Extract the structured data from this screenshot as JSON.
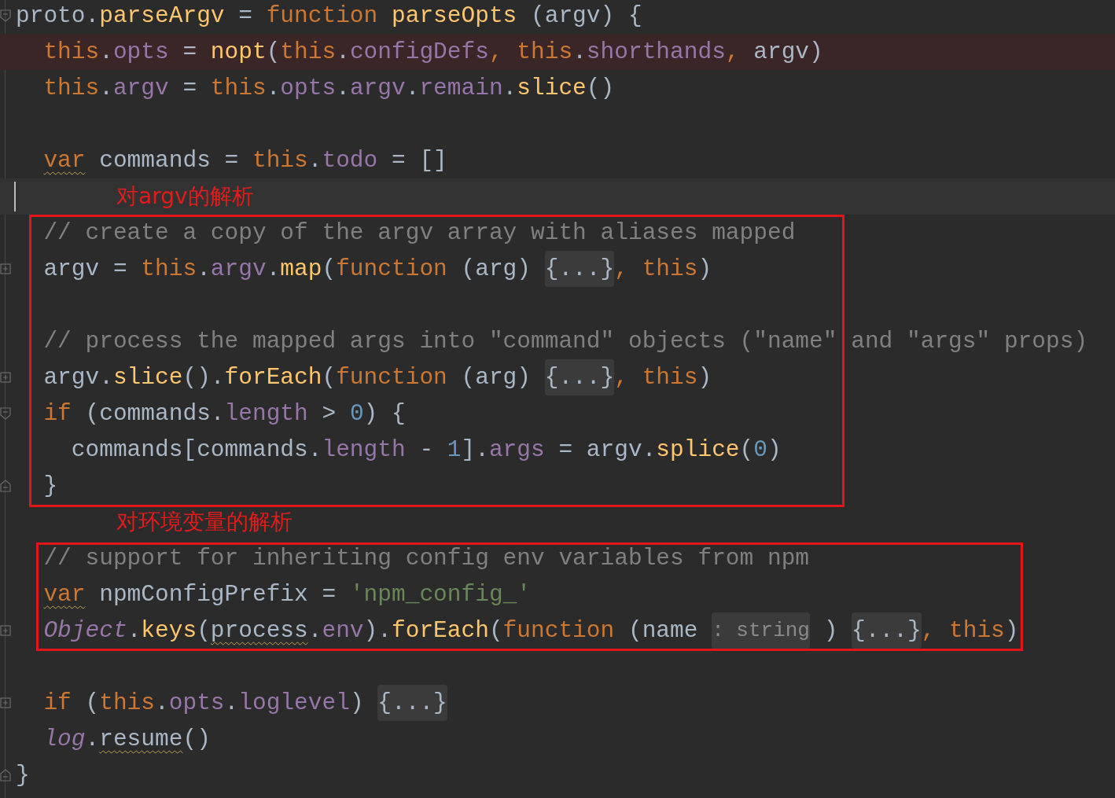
{
  "blocks": [
    {
      "boxed": false,
      "lines": [
        {
          "kind": "code",
          "gutter": {
            "kind": "start"
          },
          "tokens": [
            {
              "kind": "t",
              "s": "proto."
            },
            {
              "kind": "f",
              "s": "parseArgv"
            },
            {
              "kind": "t",
              "s": " = "
            },
            {
              "kind": "k",
              "s": "function "
            },
            {
              "kind": "f",
              "s": "parseOpts"
            },
            {
              "kind": "t",
              "s": " (argv) {"
            }
          ]
        },
        {
          "kind": "code",
          "error": true,
          "tokens": [
            {
              "kind": "k",
              "s": "  this"
            },
            {
              "kind": "t",
              "s": "."
            },
            {
              "kind": "p",
              "s": "opts"
            },
            {
              "kind": "t",
              "s": " = "
            },
            {
              "kind": "f",
              "s": "nopt"
            },
            {
              "kind": "t",
              "s": "("
            },
            {
              "kind": "k",
              "s": "this"
            },
            {
              "kind": "t",
              "s": "."
            },
            {
              "kind": "p",
              "s": "configDefs"
            },
            {
              "kind": "k",
              "s": ", this"
            },
            {
              "kind": "t",
              "s": "."
            },
            {
              "kind": "p",
              "s": "shorthands"
            },
            {
              "kind": "k",
              "s": ", "
            },
            {
              "kind": "t",
              "s": "argv)"
            }
          ]
        },
        {
          "kind": "code",
          "tokens": [
            {
              "kind": "k",
              "s": "  this"
            },
            {
              "kind": "t",
              "s": "."
            },
            {
              "kind": "p",
              "s": "argv"
            },
            {
              "kind": "t",
              "s": " = "
            },
            {
              "kind": "k",
              "s": "this"
            },
            {
              "kind": "t",
              "s": "."
            },
            {
              "kind": "p",
              "s": "opts"
            },
            {
              "kind": "t",
              "s": "."
            },
            {
              "kind": "p",
              "s": "argv"
            },
            {
              "kind": "t",
              "s": "."
            },
            {
              "kind": "p",
              "s": "remain"
            },
            {
              "kind": "t",
              "s": "."
            },
            {
              "kind": "f",
              "s": "slice"
            },
            {
              "kind": "t",
              "s": "()"
            }
          ]
        },
        {
          "kind": "blank"
        },
        {
          "kind": "code",
          "tokens": [
            {
              "kind": "k",
              "s": "  var",
              "warn": true
            },
            {
              "kind": "t",
              "s": " commands = "
            },
            {
              "kind": "k",
              "s": "this"
            },
            {
              "kind": "t",
              "s": "."
            },
            {
              "kind": "p",
              "s": "todo"
            },
            {
              "kind": "t",
              "s": " = []"
            }
          ]
        },
        {
          "kind": "annotation",
          "caret": true,
          "annotation": "对argv的解析"
        }
      ]
    },
    {
      "boxed": true,
      "lines": [
        {
          "kind": "code",
          "tokens": [
            {
              "kind": "c",
              "s": "  // create a copy of the argv array with aliases mapped"
            }
          ]
        },
        {
          "kind": "code",
          "gutter": {
            "kind": "plus"
          },
          "tokens": [
            {
              "kind": "t",
              "s": "  argv = "
            },
            {
              "kind": "k",
              "s": "this"
            },
            {
              "kind": "t",
              "s": "."
            },
            {
              "kind": "p",
              "s": "argv"
            },
            {
              "kind": "t",
              "s": "."
            },
            {
              "kind": "f",
              "s": "map"
            },
            {
              "kind": "t",
              "s": "("
            },
            {
              "kind": "k",
              "s": "function "
            },
            {
              "kind": "t",
              "s": "(arg) "
            },
            {
              "kind": "fold",
              "s": "{...}"
            },
            {
              "kind": "k",
              "s": ", this"
            },
            {
              "kind": "t",
              "s": ")"
            }
          ]
        },
        {
          "kind": "blank"
        },
        {
          "kind": "code",
          "tokens": [
            {
              "kind": "c",
              "s": "  // process the mapped args into \"command\" objects (\"name\" and \"args\" props)"
            }
          ]
        },
        {
          "kind": "code",
          "gutter": {
            "kind": "plus"
          },
          "tokens": [
            {
              "kind": "t",
              "s": "  argv."
            },
            {
              "kind": "f",
              "s": "slice"
            },
            {
              "kind": "t",
              "s": "()."
            },
            {
              "kind": "f",
              "s": "forEach"
            },
            {
              "kind": "t",
              "s": "("
            },
            {
              "kind": "k",
              "s": "function "
            },
            {
              "kind": "t",
              "s": "(arg) "
            },
            {
              "kind": "fold",
              "s": "{...}"
            },
            {
              "kind": "k",
              "s": ", this"
            },
            {
              "kind": "t",
              "s": ")"
            }
          ]
        },
        {
          "kind": "code",
          "gutter": {
            "kind": "start"
          },
          "tokens": [
            {
              "kind": "k",
              "s": "  if "
            },
            {
              "kind": "t",
              "s": "(commands."
            },
            {
              "kind": "p",
              "s": "length"
            },
            {
              "kind": "t",
              "s": " > "
            },
            {
              "kind": "n",
              "s": "0"
            },
            {
              "kind": "t",
              "s": ") {"
            }
          ]
        },
        {
          "kind": "code",
          "tokens": [
            {
              "kind": "t",
              "s": "    commands[commands."
            },
            {
              "kind": "p",
              "s": "length"
            },
            {
              "kind": "t",
              "s": " - "
            },
            {
              "kind": "n",
              "s": "1"
            },
            {
              "kind": "t",
              "s": "]."
            },
            {
              "kind": "p",
              "s": "args"
            },
            {
              "kind": "t",
              "s": " = argv."
            },
            {
              "kind": "f",
              "s": "splice"
            },
            {
              "kind": "t",
              "s": "("
            },
            {
              "kind": "n",
              "s": "0"
            },
            {
              "kind": "t",
              "s": ")"
            }
          ]
        },
        {
          "kind": "code",
          "gutter": {
            "kind": "end"
          },
          "tokens": [
            {
              "kind": "t",
              "s": "  }"
            }
          ]
        }
      ]
    },
    {
      "boxed": false,
      "lines": [
        {
          "kind": "annotation",
          "annotation": "对环境变量的解析"
        }
      ]
    },
    {
      "boxed": true,
      "lines": [
        {
          "kind": "code",
          "tokens": [
            {
              "kind": "c",
              "s": "  // support for inheriting config env variables from npm"
            }
          ]
        },
        {
          "kind": "code",
          "tokens": [
            {
              "kind": "k",
              "s": "  var",
              "warn": true
            },
            {
              "kind": "t",
              "s": " npmConfigPrefix = "
            },
            {
              "kind": "s",
              "s": "'npm_config_'"
            }
          ]
        },
        {
          "kind": "code",
          "gutter": {
            "kind": "plus"
          },
          "tokens": [
            {
              "kind": "i",
              "s": "  Object"
            },
            {
              "kind": "t",
              "s": "."
            },
            {
              "kind": "f",
              "s": "keys"
            },
            {
              "kind": "t",
              "s": "("
            },
            {
              "kind": "t",
              "s": "process",
              "warn": true
            },
            {
              "kind": "t",
              "s": "."
            },
            {
              "kind": "p",
              "s": "env"
            },
            {
              "kind": "t",
              "s": ")."
            },
            {
              "kind": "f",
              "s": "forEach"
            },
            {
              "kind": "t",
              "s": "("
            },
            {
              "kind": "k",
              "s": "function "
            },
            {
              "kind": "t",
              "s": "(name "
            },
            {
              "kind": "hint",
              "s": ": string"
            },
            {
              "kind": "t",
              "s": " ) "
            },
            {
              "kind": "fold",
              "s": "{...}"
            },
            {
              "kind": "k",
              "s": ", this"
            },
            {
              "kind": "t",
              "s": ")"
            }
          ]
        }
      ]
    },
    {
      "boxed": false,
      "lines": [
        {
          "kind": "blank"
        },
        {
          "kind": "code",
          "gutter": {
            "kind": "plus"
          },
          "tokens": [
            {
              "kind": "k",
              "s": "  if "
            },
            {
              "kind": "t",
              "s": "("
            },
            {
              "kind": "k",
              "s": "this"
            },
            {
              "kind": "t",
              "s": "."
            },
            {
              "kind": "p",
              "s": "opts"
            },
            {
              "kind": "t",
              "s": "."
            },
            {
              "kind": "p",
              "s": "loglevel"
            },
            {
              "kind": "t",
              "s": ") "
            },
            {
              "kind": "fold",
              "s": "{...}"
            }
          ]
        },
        {
          "kind": "code",
          "tokens": [
            {
              "kind": "i",
              "s": "  log"
            },
            {
              "kind": "t",
              "s": "."
            },
            {
              "kind": "t",
              "s": "resume",
              "warn": true
            },
            {
              "kind": "t",
              "s": "()"
            }
          ]
        },
        {
          "kind": "code",
          "gutter": {
            "kind": "end"
          },
          "tokens": [
            {
              "kind": "t",
              "s": "}"
            }
          ]
        }
      ]
    }
  ]
}
